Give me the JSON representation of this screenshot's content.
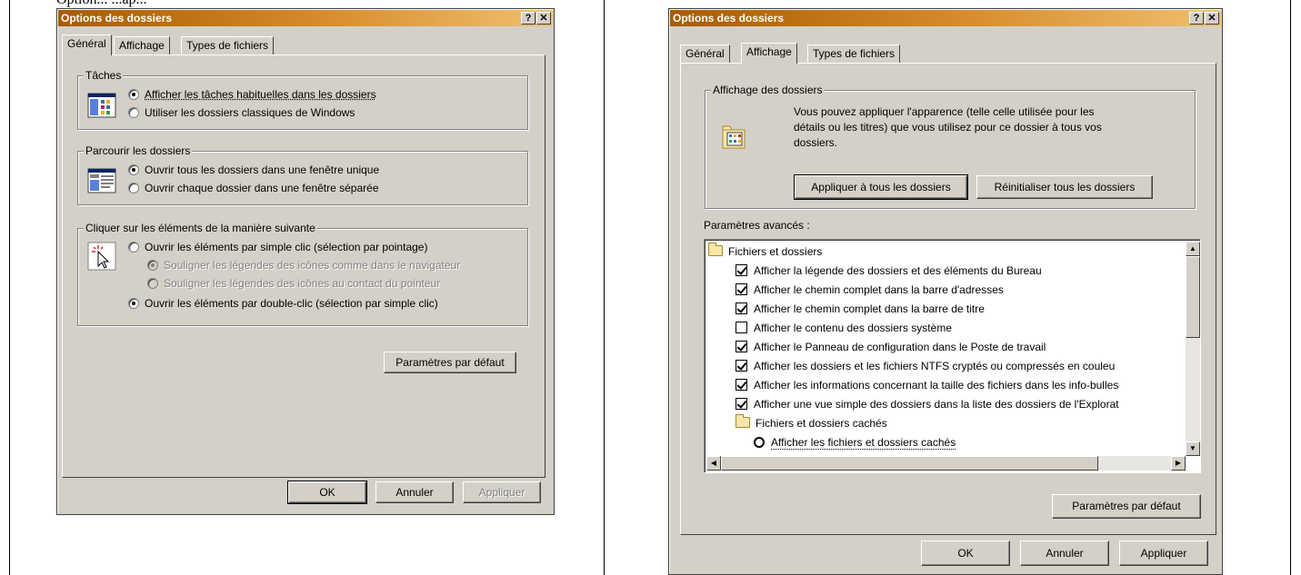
{
  "page": {
    "top_text": "Option...      ...ap..."
  },
  "left_dialog": {
    "title": "Options des dossiers",
    "help_btn": "?",
    "close_btn": "✕",
    "tabs": [
      {
        "label": "Général",
        "active": true
      },
      {
        "label": "Affichage",
        "active": false
      },
      {
        "label": "Types de fichiers",
        "active": false
      }
    ],
    "groups": {
      "taches": {
        "label": "Tâches",
        "options": [
          {
            "label": "Afficher les tâches habituelles dans les dossiers",
            "checked": true
          },
          {
            "label": "Utiliser les dossiers classiques de Windows",
            "checked": false
          }
        ]
      },
      "parcourir": {
        "label": "Parcourir les dossiers",
        "options": [
          {
            "label": "Ouvrir tous les dossiers dans une fenêtre unique",
            "checked": true
          },
          {
            "label": "Ouvrir chaque dossier dans une fenêtre séparée",
            "checked": false
          }
        ]
      },
      "cliquer": {
        "label": "Cliquer sur les éléments de la manière suivante",
        "options": [
          {
            "label": "Ouvrir les éléments par simple clic (sélection par pointage)",
            "checked": false
          },
          {
            "label": "Souligner les légendes des icônes comme dans le navigateur",
            "checked": true,
            "disabled": true
          },
          {
            "label": "Souligner les légendes des icônes au contact du pointeur",
            "checked": false,
            "disabled": true
          },
          {
            "label": "Ouvrir les éléments par double-clic (sélection par simple clic)",
            "checked": true
          }
        ]
      }
    },
    "default_btn": "Paramètres par défaut",
    "ok_btn": "OK",
    "cancel_btn": "Annuler",
    "apply_btn": "Appliquer"
  },
  "right_dialog": {
    "title": "Options des dossiers",
    "help_btn": "?",
    "close_btn": "✕",
    "tabs": [
      {
        "label": "Général",
        "active": false
      },
      {
        "label": "Affichage",
        "active": true
      },
      {
        "label": "Types de fichiers",
        "active": false
      }
    ],
    "view_group": {
      "label": "Affichage des dossiers",
      "description_lines": [
        "Vous pouvez appliquer l'apparence (telle celle utilisée pour les",
        "détails ou les titres) que vous utilisez pour ce dossier à tous vos",
        "dossiers."
      ],
      "apply_all_btn": "Appliquer à tous les dossiers",
      "reset_all_btn": "Réinitialiser tous les dossiers"
    },
    "advanced_label": "Paramètres avancés :",
    "tree": [
      {
        "type": "folder",
        "level": 0,
        "label": "Fichiers et dossiers"
      },
      {
        "type": "checkbox",
        "level": 1,
        "checked": true,
        "label": "Afficher la légende des dossiers et des éléments du Bureau"
      },
      {
        "type": "checkbox",
        "level": 1,
        "checked": true,
        "label": "Afficher le chemin complet dans la barre d'adresses"
      },
      {
        "type": "checkbox",
        "level": 1,
        "checked": true,
        "label": "Afficher le chemin complet dans la barre de titre"
      },
      {
        "type": "checkbox",
        "level": 1,
        "checked": false,
        "label": "Afficher le contenu des dossiers système"
      },
      {
        "type": "checkbox",
        "level": 1,
        "checked": true,
        "label": "Afficher le Panneau de configuration dans le Poste de travail"
      },
      {
        "type": "checkbox",
        "level": 1,
        "checked": true,
        "label": "Afficher les dossiers et les fichiers NTFS cryptés ou compressés en couleu"
      },
      {
        "type": "checkbox",
        "level": 1,
        "checked": true,
        "label": "Afficher les informations concernant la taille des fichiers dans les info-bulles"
      },
      {
        "type": "checkbox",
        "level": 1,
        "checked": true,
        "label": "Afficher une vue simple des dossiers dans la liste des dossiers de l'Explorat"
      },
      {
        "type": "folder",
        "level": 1,
        "label": "Fichiers et dossiers cachés"
      },
      {
        "type": "radio",
        "level": 2,
        "checked": false,
        "label": "Afficher les fichiers et dossiers cachés"
      }
    ],
    "default_btn": "Paramètres par défaut",
    "ok_btn": "OK",
    "cancel_btn": "Annuler",
    "apply_btn": "Appliquer"
  }
}
